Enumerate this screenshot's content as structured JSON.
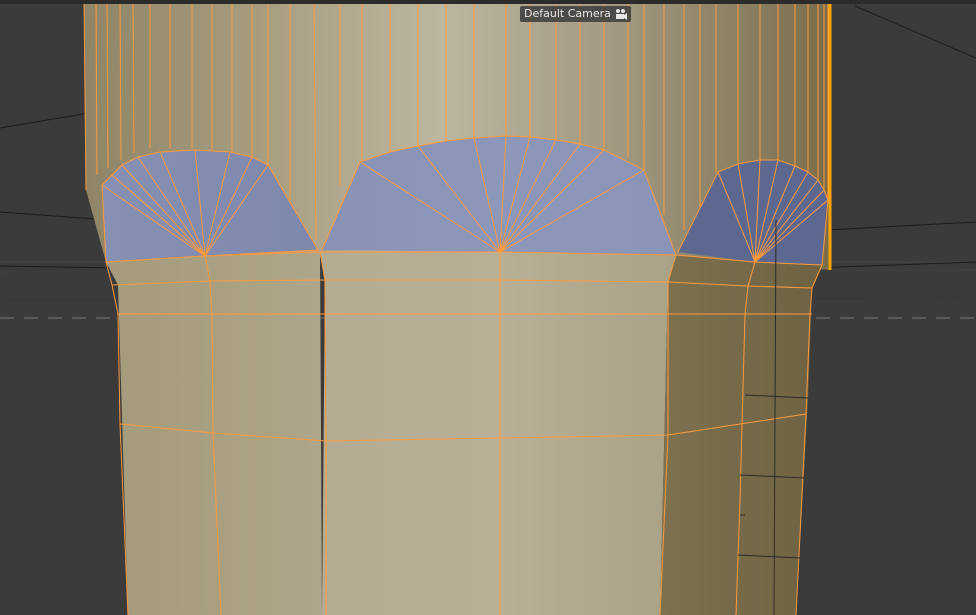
{
  "viewport": {
    "camera_label": "Default Camera",
    "camera_icon": "camera-icon",
    "colors": {
      "background": "#3b3b3b",
      "mesh_fill": "#b6ae92",
      "mesh_shadow": "#7a6e4c",
      "selected_faces": "#8a94b8",
      "selected_faces_dark": "#5c6790",
      "edge": "#ff9a3c",
      "selection_edge": "#ffa033",
      "grid_line": "#555555",
      "dash_line": "#6a6a6a"
    }
  }
}
